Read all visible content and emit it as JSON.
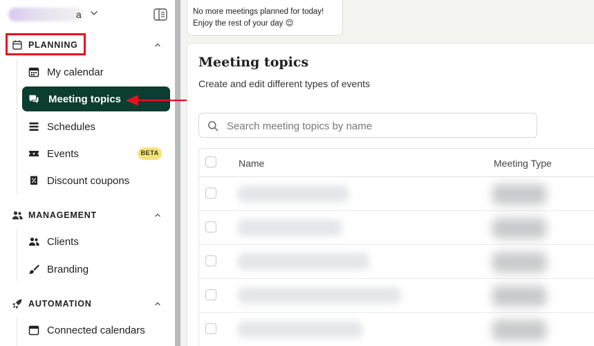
{
  "workspace": {
    "name_tail": "a"
  },
  "sections": [
    {
      "id": "planning",
      "title": "PLANNING",
      "icon": "calendar-icon"
    },
    {
      "id": "management",
      "title": "MANAGEMENT",
      "icon": "users-icon"
    },
    {
      "id": "automation",
      "title": "AUTOMATION",
      "icon": "rocket-icon"
    }
  ],
  "nav": {
    "my_calendar": "My calendar",
    "meeting_topics": "Meeting topics",
    "schedules": "Schedules",
    "events": "Events",
    "events_badge": "BETA",
    "discount_coupons": "Discount coupons",
    "clients": "Clients",
    "branding": "Branding",
    "connected_calendars": "Connected calendars"
  },
  "toast": {
    "line1": "No more meetings planned for today!",
    "line2": "Enjoy the rest of your day 😌"
  },
  "main": {
    "title": "Meeting topics",
    "subtitle": "Create and edit different types of events",
    "search_placeholder": "Search meeting topics by name",
    "table": {
      "columns": [
        "Name",
        "Meeting Type"
      ],
      "row_count": 5
    }
  },
  "colors": {
    "active_nav_bg": "#0b3d30",
    "annotation_red": "#e5121e",
    "beta_badge": "#f6e27a"
  }
}
